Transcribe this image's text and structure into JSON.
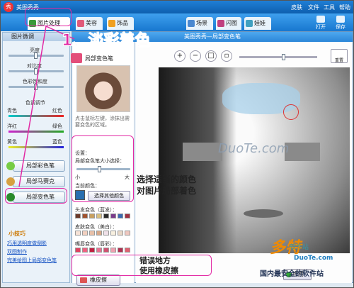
{
  "app": {
    "title": "美图秀秀",
    "menu": [
      "皮肤",
      "文件",
      "工具",
      "帮助"
    ]
  },
  "toolbar": {
    "tabs": [
      {
        "label": "图片处理",
        "color": "#3a9a3a"
      },
      {
        "label": "美容",
        "color": "#e05a7a"
      },
      {
        "label": "饰品",
        "color": "#f0a020"
      },
      {
        "label": "场景",
        "color": "#4a88d0"
      },
      {
        "label": "闪图",
        "color": "#c04080"
      },
      {
        "label": "娃娃",
        "color": "#40a0c0"
      }
    ],
    "open_label": "打开",
    "save_label": "保存"
  },
  "sidebar": {
    "header": "图片微调",
    "sliders": [
      "亮度",
      "对比度",
      "色彩饱和度",
      "色调调节"
    ],
    "color_pairs": [
      [
        "青色",
        "红色"
      ],
      [
        "洋红",
        "绿色"
      ],
      [
        "黄色",
        "蓝色"
      ]
    ],
    "buttons": [
      "局部彩色笔",
      "局部马赛克",
      "局部变色笔"
    ],
    "tips_title": "小技巧",
    "tips": [
      "巧用透明度做倒影",
      "双图制作",
      "完美给图上局部变色笔"
    ]
  },
  "dialog": {
    "title": "美图秀秀—局部变色笔",
    "panel_title": "局部变色笔",
    "description": "点击鼠标左键，涂抹出需要变色的区域。",
    "settings_label": "设置：",
    "brush_size_label": "局部变色笔大小选择：",
    "size_small": "小",
    "size_large": "大",
    "current_color_label": "当前颜色：",
    "current_color": "#2a6fb0",
    "pick_color_label": "选择其他颜色",
    "groups": [
      {
        "label": "头发变色（蓝发）：",
        "colors": [
          "#6b3a2a",
          "#a0522d",
          "#c8a060",
          "#d8c080",
          "#2a2a2a",
          "#7a3a8a",
          "#3a6ab0",
          "#a03040"
        ]
      },
      {
        "label": "皮肤变色（美白）：",
        "colors": [
          "#f6e2d6",
          "#f2d0c0",
          "#e8c0a8",
          "#d8a888",
          "#f0e0e8",
          "#f8f0e0",
          "#e8d8c8",
          "#f0c8c0"
        ]
      },
      {
        "label": "嘴唇变色（唇彩）：",
        "colors": [
          "#e04060",
          "#f06080",
          "#c02040",
          "#e87090",
          "#d05070",
          "#f0a0b0",
          "#b03050",
          "#e06070"
        ]
      }
    ],
    "eraser_label": "橡皮擦",
    "apply_label": "应用",
    "zoom_reset_label": "重置"
  },
  "annotations": {
    "step_title": "1、淡彩着色",
    "note_color": "选择适当的颜色\n对图片局部着色",
    "note_eraser": "错误地方\n使用橡皮擦",
    "watermark": "DuoTe.com"
  },
  "brand": {
    "name": "多特",
    "sub": "软件站",
    "site": "DuoTe.com",
    "slogan": "国内最安全的软件站"
  }
}
